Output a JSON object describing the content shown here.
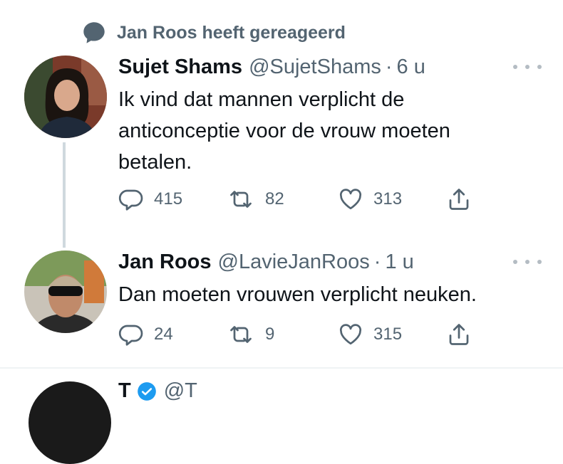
{
  "context": {
    "text": "Jan Roos heeft gereageerd",
    "icon": "speech-bubble-icon"
  },
  "tweets": [
    {
      "name": "Sujet Shams",
      "handle": "@SujetShams",
      "dot": "·",
      "time": "6 u",
      "text_lines": [
        "Ik vind dat mannen verplicht de",
        "anticonceptie voor de vrouw moeten",
        "betalen."
      ],
      "stats": {
        "replies": "415",
        "retweets": "82",
        "likes": "313"
      }
    },
    {
      "name": "Jan Roos",
      "handle": "@LavieJanRoos",
      "dot": "·",
      "time": "1 u",
      "text_lines": [
        "Dan moeten vrouwen verplicht neuken."
      ],
      "stats": {
        "replies": "24",
        "retweets": "9",
        "likes": "315"
      }
    }
  ],
  "next_tweet": {
    "name": "T",
    "handle": "@T"
  },
  "colors": {
    "text": "#0f1419",
    "secondary": "#536471",
    "thread_line": "#cfd9de",
    "verified": "#1d9bf0"
  }
}
